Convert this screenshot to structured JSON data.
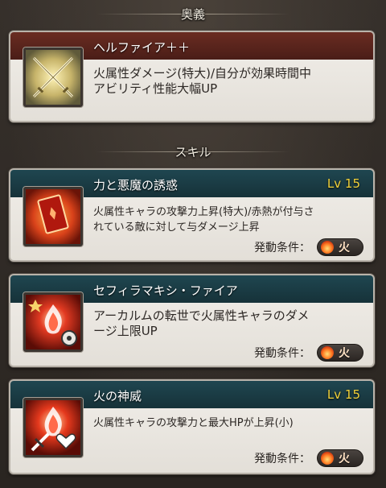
{
  "sections": {
    "ougi_title": "奥義",
    "skill_title": "スキル"
  },
  "ougi": {
    "name": "ヘルファイア＋＋",
    "desc_line1": "火属性ダメージ(特大)/自分が効果時間中",
    "desc_line2": "アビリティ性能大幅UP",
    "icon": "crossed-swords-icon"
  },
  "skills": [
    {
      "name": "力と悪魔の誘惑",
      "level": "Lv 15",
      "desc_line1": "火属性キャラの攻撃力上昇(特大)/赤熱が付与さ",
      "desc_line2": "れている敵に対して与ダメージ上昇",
      "condition_label": "発動条件：",
      "element": "火",
      "icon": "devil-card-icon"
    },
    {
      "name": "セフィラマキシ・ファイア",
      "level": "",
      "desc_line1": "アーカルムの転世で火属性キャラのダメ",
      "desc_line2": "ージ上限UP",
      "condition_label": "発動条件：",
      "element": "火",
      "icon": "fire-gear-icon"
    },
    {
      "name": "火の神威",
      "level": "Lv 15",
      "desc_line1": "火属性キャラの攻撃力と最大HPが上昇(小)",
      "desc_line2": "",
      "condition_label": "発動条件：",
      "element": "火",
      "icon": "fire-sword-heart-icon"
    }
  ],
  "colors": {
    "level_text": "#f2d23a",
    "ougi_header": "#5a251c",
    "skill_header": "#1b3c45"
  }
}
